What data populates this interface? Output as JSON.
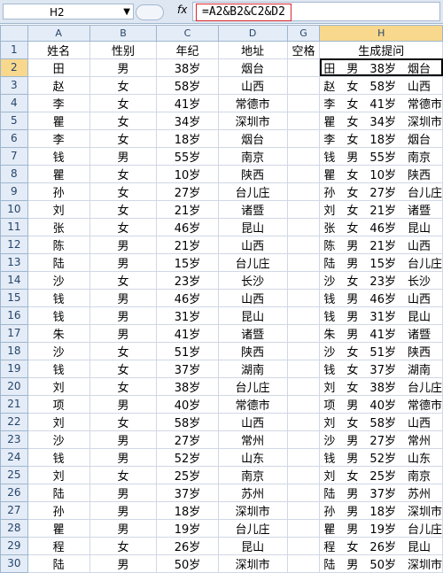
{
  "formula_bar": {
    "name_box": "H2",
    "fx_label": "fx",
    "formula": "=A2&B2&C2&D2"
  },
  "columns": [
    "A",
    "B",
    "C",
    "D",
    "G",
    "H"
  ],
  "headers": {
    "A": "姓名",
    "B": "性别",
    "C": "年纪",
    "D": "地址",
    "G": "空格",
    "H": "生成提问"
  },
  "rows": [
    {
      "n": "2",
      "name": "田",
      "sex": "男",
      "age": "38岁",
      "addr": "烟台",
      "h": "田　男　38岁　烟台"
    },
    {
      "n": "3",
      "name": "赵",
      "sex": "女",
      "age": "58岁",
      "addr": "山西",
      "h": "赵　女　58岁　山西"
    },
    {
      "n": "4",
      "name": "李",
      "sex": "女",
      "age": "41岁",
      "addr": "常德市",
      "h": "李　女　41岁　常德市"
    },
    {
      "n": "5",
      "name": "瞿",
      "sex": "女",
      "age": "34岁",
      "addr": "深圳市",
      "h": "瞿　女　34岁　深圳市"
    },
    {
      "n": "6",
      "name": "李",
      "sex": "女",
      "age": "18岁",
      "addr": "烟台",
      "h": "李　女　18岁　烟台"
    },
    {
      "n": "7",
      "name": "钱",
      "sex": "男",
      "age": "55岁",
      "addr": "南京",
      "h": "钱　男　55岁　南京"
    },
    {
      "n": "8",
      "name": "瞿",
      "sex": "女",
      "age": "10岁",
      "addr": "陕西",
      "h": "瞿　女　10岁　陕西"
    },
    {
      "n": "9",
      "name": "孙",
      "sex": "女",
      "age": "27岁",
      "addr": "台儿庄",
      "h": "孙　女　27岁　台儿庄"
    },
    {
      "n": "10",
      "name": "刘",
      "sex": "女",
      "age": "21岁",
      "addr": "诸暨",
      "h": "刘　女　21岁　诸暨"
    },
    {
      "n": "11",
      "name": "张",
      "sex": "女",
      "age": "46岁",
      "addr": "昆山",
      "h": "张　女　46岁　昆山"
    },
    {
      "n": "12",
      "name": "陈",
      "sex": "男",
      "age": "21岁",
      "addr": "山西",
      "h": "陈　男　21岁　山西"
    },
    {
      "n": "13",
      "name": "陆",
      "sex": "男",
      "age": "15岁",
      "addr": "台儿庄",
      "h": "陆　男　15岁　台儿庄"
    },
    {
      "n": "14",
      "name": "沙",
      "sex": "女",
      "age": "23岁",
      "addr": "长沙",
      "h": "沙　女　23岁　长沙"
    },
    {
      "n": "15",
      "name": "钱",
      "sex": "男",
      "age": "46岁",
      "addr": "山西",
      "h": "钱　男　46岁　山西"
    },
    {
      "n": "16",
      "name": "钱",
      "sex": "男",
      "age": "31岁",
      "addr": "昆山",
      "h": "钱　男　31岁　昆山"
    },
    {
      "n": "17",
      "name": "朱",
      "sex": "男",
      "age": "41岁",
      "addr": "诸暨",
      "h": "朱　男　41岁　诸暨"
    },
    {
      "n": "18",
      "name": "沙",
      "sex": "女",
      "age": "51岁",
      "addr": "陕西",
      "h": "沙　女　51岁　陕西"
    },
    {
      "n": "19",
      "name": "钱",
      "sex": "女",
      "age": "37岁",
      "addr": "湖南",
      "h": "钱　女　37岁　湖南"
    },
    {
      "n": "20",
      "name": "刘",
      "sex": "女",
      "age": "38岁",
      "addr": "台儿庄",
      "h": "刘　女　38岁　台儿庄"
    },
    {
      "n": "21",
      "name": "项",
      "sex": "男",
      "age": "40岁",
      "addr": "常德市",
      "h": "项　男　40岁　常德市"
    },
    {
      "n": "22",
      "name": "刘",
      "sex": "女",
      "age": "58岁",
      "addr": "山西",
      "h": "刘　女　58岁　山西"
    },
    {
      "n": "23",
      "name": "沙",
      "sex": "男",
      "age": "27岁",
      "addr": "常州",
      "h": "沙　男　27岁　常州"
    },
    {
      "n": "24",
      "name": "钱",
      "sex": "男",
      "age": "52岁",
      "addr": "山东",
      "h": "钱　男　52岁　山东"
    },
    {
      "n": "25",
      "name": "刘",
      "sex": "女",
      "age": "25岁",
      "addr": "南京",
      "h": "刘　女　25岁　南京"
    },
    {
      "n": "26",
      "name": "陆",
      "sex": "男",
      "age": "37岁",
      "addr": "苏州",
      "h": "陆　男　37岁　苏州"
    },
    {
      "n": "27",
      "name": "孙",
      "sex": "男",
      "age": "18岁",
      "addr": "深圳市",
      "h": "孙　男　18岁　深圳市"
    },
    {
      "n": "28",
      "name": "瞿",
      "sex": "男",
      "age": "19岁",
      "addr": "台儿庄",
      "h": "瞿　男　19岁　台儿庄"
    },
    {
      "n": "29",
      "name": "程",
      "sex": "女",
      "age": "26岁",
      "addr": "昆山",
      "h": "程　女　26岁　昆山"
    },
    {
      "n": "30",
      "name": "陆",
      "sex": "男",
      "age": "50岁",
      "addr": "深圳市",
      "h": "陆　男　50岁　深圳市"
    }
  ],
  "header_row_number": "1",
  "selected_cell": "H2"
}
